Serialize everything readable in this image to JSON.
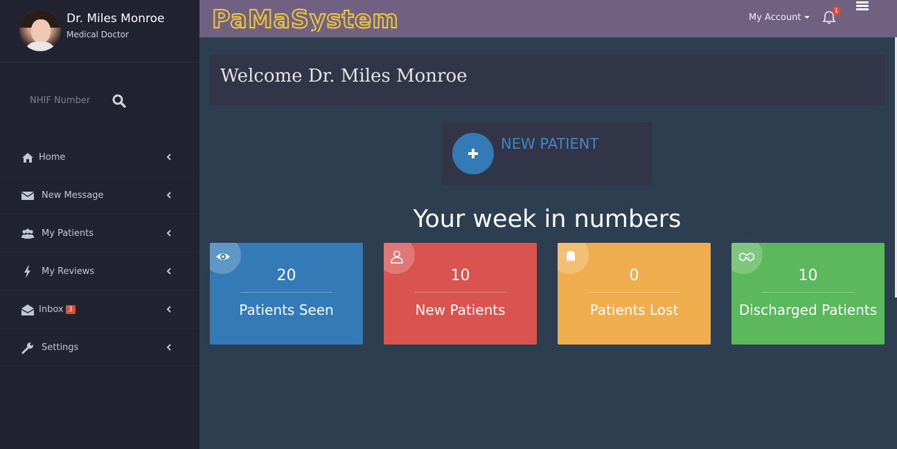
{
  "profile": {
    "name": "Dr. Miles Monroe",
    "role": "Medical Doctor"
  },
  "search": {
    "placeholder": "NHIF Number"
  },
  "nav": {
    "home": "Home",
    "message": "New Message",
    "patients": "My Patients",
    "reviews": "My Reviews",
    "inbox": "Inbox",
    "inbox_count": "3",
    "settings": "Settings"
  },
  "header": {
    "logo": "PaMaSystem",
    "account": "My Account",
    "notif_count": "1",
    "color": "#706082"
  },
  "welcome": "Welcome Dr. Miles Monroe",
  "new_patient": "NEW PATIENT",
  "week_title": "Your week in numbers",
  "stats": [
    {
      "value": "20",
      "label": "Patients Seen",
      "color": "#337ab7",
      "icon": "eye-icon"
    },
    {
      "value": "10",
      "label": "New Patients",
      "color": "#d9534f",
      "icon": "user-icon"
    },
    {
      "value": "0",
      "label": "Patients Lost",
      "color": "#f0ad4e",
      "icon": "ghost-icon"
    },
    {
      "value": "10",
      "label": "Discharged Patients",
      "color": "#5cb85c",
      "icon": "handshake-icon"
    }
  ]
}
